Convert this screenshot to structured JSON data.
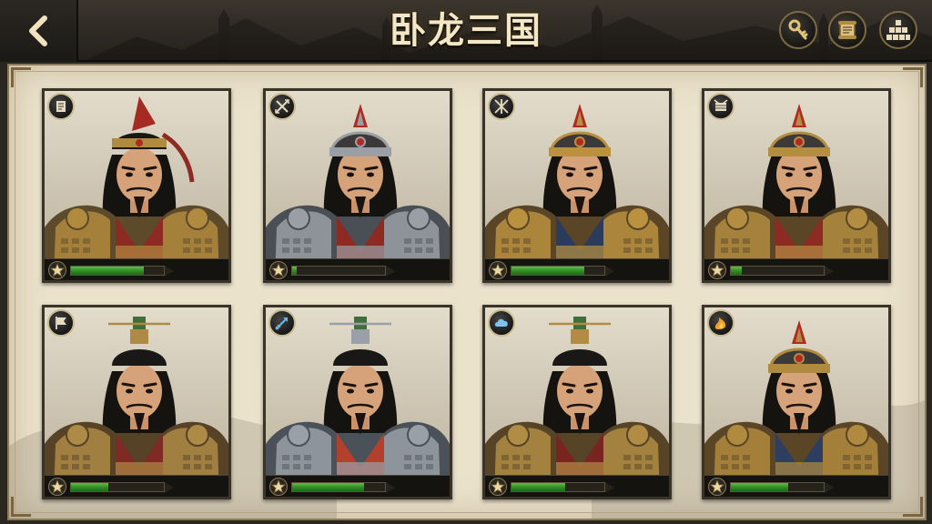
{
  "header": {
    "title": "卧龙三国",
    "back_icon": "chevron-left-icon",
    "actions": [
      {
        "name": "key-button",
        "icon": "key-icon"
      },
      {
        "name": "scroll-button",
        "icon": "scroll-icon"
      },
      {
        "name": "formation-button",
        "icon": "formation-icon"
      }
    ]
  },
  "colors": {
    "bar_fill": "#3f9e2e",
    "panel": "#ebe2cc",
    "frame": "#3a3328",
    "gold": "#c9a64a"
  },
  "generals": [
    {
      "class_icon": "scroll-class-icon",
      "headgear": "headband",
      "progress": 0.78
    },
    {
      "class_icon": "crossed-swords-class-icon",
      "headgear": "helmet",
      "progress": 0.05
    },
    {
      "class_icon": "crossed-spears-class-icon",
      "headgear": "helmet",
      "progress": 0.78
    },
    {
      "class_icon": "war-drum-class-icon",
      "headgear": "helmet",
      "progress": 0.12
    },
    {
      "class_icon": "flag-class-icon",
      "headgear": "topknot-crown",
      "progress": 0.4
    },
    {
      "class_icon": "arrow-class-icon",
      "headgear": "topknot-crown",
      "progress": 0.77
    },
    {
      "class_icon": "cloud-class-icon",
      "headgear": "topknot-crown",
      "progress": 0.58
    },
    {
      "class_icon": "fire-class-icon",
      "headgear": "helmet",
      "progress": 0.62
    }
  ]
}
